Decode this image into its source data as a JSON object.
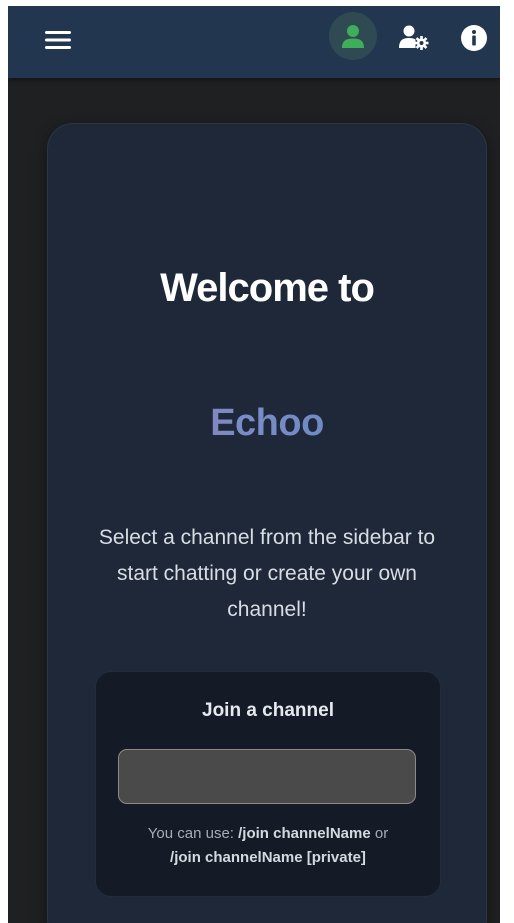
{
  "topbar": {
    "menu_icon": "hamburger-menu-icon",
    "profile_icon": "user-icon",
    "settings_icon": "user-settings-icon",
    "info_icon": "info-icon",
    "colors": {
      "background": "#233650",
      "profile_accent": "#3fae5a"
    }
  },
  "welcome": {
    "heading": "Welcome to",
    "brand": "Echoo",
    "subtitle": "Select a channel from the sidebar to start chatting or create your own channel!"
  },
  "join": {
    "title": "Join a channel",
    "input_value": "",
    "help_prefix": "You can use: ",
    "help_cmd1": "/join channelName",
    "help_middle": " or ",
    "help_cmd2": "/join channelName [private]"
  }
}
